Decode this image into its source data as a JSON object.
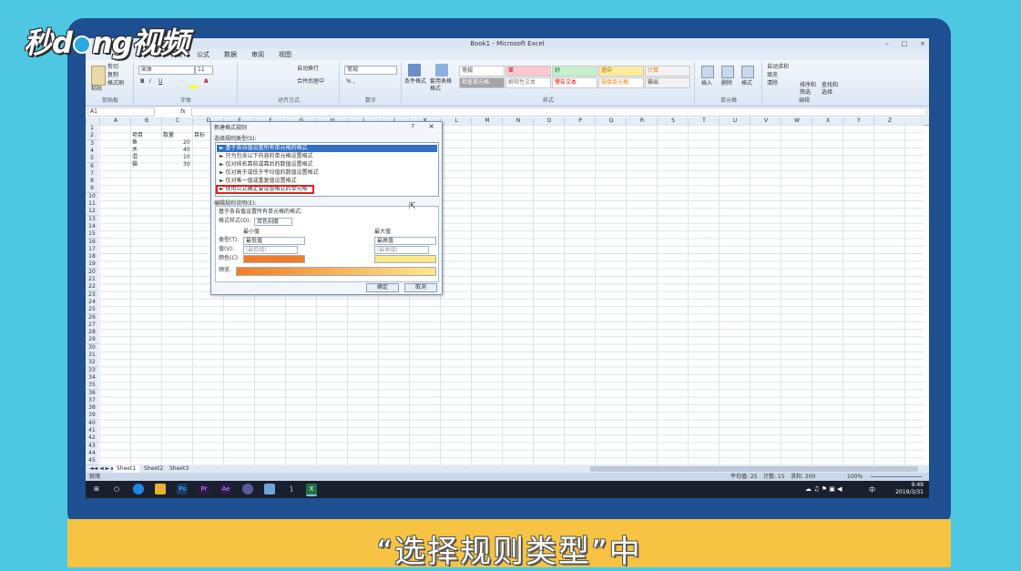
{
  "logo": {
    "text_left": "秒",
    "text_mid": "d",
    "text_right": "ng视频"
  },
  "caption": "“选择规则类型”中",
  "window": {
    "title": "Book1 - Microsoft Excel",
    "controls": [
      "–",
      "□",
      "×"
    ]
  },
  "menu": [
    "布局",
    "公式",
    "数据",
    "审阅",
    "视图"
  ],
  "ribbon": {
    "clipboard": {
      "paste": "粘贴",
      "cut": "剪切",
      "copy": "复制",
      "format_painter": "格式刷",
      "label": "剪贴板"
    },
    "font": {
      "name": "宋体",
      "size": "11",
      "label": "字体"
    },
    "alignment": {
      "wrap": "自动换行",
      "merge": "合并后居中",
      "label": "对齐方式"
    },
    "number": {
      "format": "常规",
      "label": "数字"
    },
    "styles": {
      "cond_format": "条件格式",
      "table_format": "套用表格格式",
      "cells": [
        {
          "text": "常规",
          "bg": "#ffffff",
          "fg": "#333333"
        },
        {
          "text": "差",
          "bg": "#ffc7ce",
          "fg": "#9c0006"
        },
        {
          "text": "好",
          "bg": "#c6efce",
          "fg": "#006100"
        },
        {
          "text": "适中",
          "bg": "#ffeb9c",
          "fg": "#9c6500"
        },
        {
          "text": "计算",
          "bg": "#f2f2f2",
          "fg": "#fa7d00"
        },
        {
          "text": "检查单元格",
          "bg": "#a5a5a5",
          "fg": "#ffffff"
        },
        {
          "text": "解释性文本",
          "bg": "#ffffff",
          "fg": "#7f7f7f"
        },
        {
          "text": "警告文本",
          "bg": "#ffffff",
          "fg": "#ff0000"
        },
        {
          "text": "链接单元格",
          "bg": "#ffffff",
          "fg": "#fa7d00"
        },
        {
          "text": "输出",
          "bg": "#f2f2f2",
          "fg": "#3f3f3f"
        }
      ],
      "label": "样式"
    },
    "cells_group": {
      "insert": "插入",
      "delete": "删除",
      "format": "格式",
      "label": "单元格"
    },
    "editing": {
      "autosum": "自动求和",
      "fill": "填充",
      "clear": "清除",
      "sort": "排序和筛选",
      "find": "查找和选择",
      "label": "编辑"
    }
  },
  "formula_bar": {
    "name_box": "A1",
    "fx": "fx"
  },
  "columns": [
    "A",
    "B",
    "C",
    "D",
    "E",
    "F",
    "G",
    "H",
    "I",
    "J",
    "K",
    "L",
    "M",
    "N",
    "O",
    "P",
    "Q",
    "R",
    "S",
    "T",
    "U",
    "V",
    "W",
    "X",
    "Y",
    "Z"
  ],
  "sheet_cells": [
    {
      "text": "项目"
    },
    {
      "text": "数量"
    },
    {
      "text": "目标"
    },
    {
      "text": "鱼"
    },
    {
      "text": "20"
    },
    {
      "text": "木"
    },
    {
      "text": "40"
    },
    {
      "text": "混"
    },
    {
      "text": "10"
    },
    {
      "text": "猫"
    },
    {
      "text": "30"
    }
  ],
  "sheet_tabs": [
    "Sheet1",
    "Sheet2",
    "Sheet3"
  ],
  "status": {
    "mode": "就绪",
    "average": "平均值: 25",
    "count": "计数: 15",
    "sum": "求和: 200",
    "zoom": "100%"
  },
  "taskbar": {
    "time": "9:49",
    "date": "2019/3/31",
    "ime": "中"
  },
  "dialog": {
    "title": "新建格式规则",
    "help": "?",
    "close": "×",
    "select_rule_label": "选择规则类型(S):",
    "rules": [
      "► 基于各自值设置所有单元格的格式",
      "► 只为包含以下内容的单元格设置格式",
      "► 仅对排名靠前或靠后的数值设置格式",
      "► 仅对高于或低于平均值的数值设置格式",
      "► 仅对唯一值或重复值设置格式",
      "► 使用公式确定要设置格式的单元格"
    ],
    "edit_label": "编辑规则说明(E):",
    "edit_heading": "基于各自值设置所有单元格的格式:",
    "format_style_label": "格式样式(O):",
    "format_style_value": "双色刻度",
    "min_label": "最小值",
    "max_label": "最大值",
    "type_label": "类型(T):",
    "value_label": "值(V):",
    "color_label": "颜色(C):",
    "min_type": "最低值",
    "max_type": "最高值",
    "min_value": "(最低值)",
    "max_value": "(最高值)",
    "min_color": "#f07d2a",
    "max_color": "#ffe88a",
    "preview_label": "预览:",
    "ok": "确定",
    "cancel": "取消"
  }
}
